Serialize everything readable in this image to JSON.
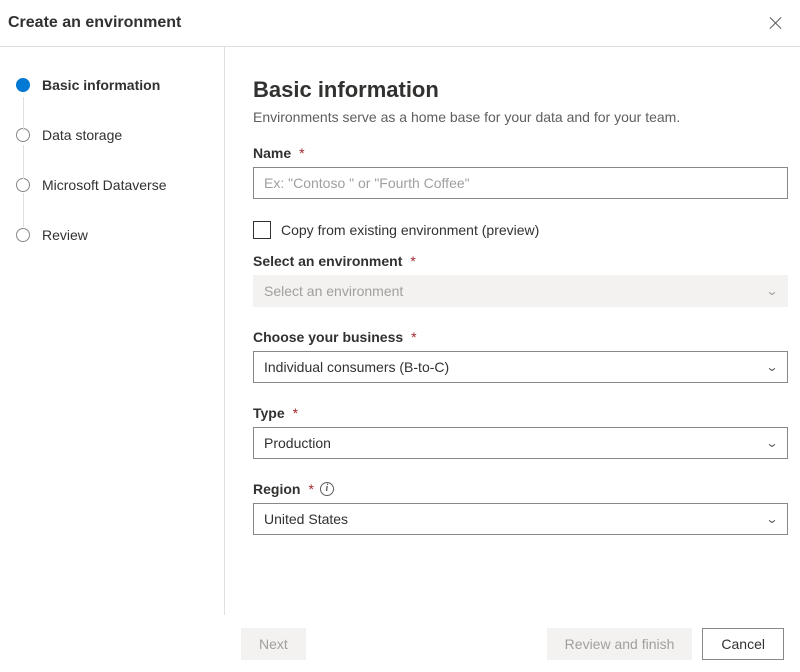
{
  "header": {
    "title": "Create an environment"
  },
  "sidebar": {
    "steps": [
      {
        "label": "Basic information",
        "active": true
      },
      {
        "label": "Data storage",
        "active": false
      },
      {
        "label": "Microsoft Dataverse",
        "active": false
      },
      {
        "label": "Review",
        "active": false
      }
    ]
  },
  "main": {
    "heading": "Basic information",
    "description": "Environments serve as a home base for your data and for your team.",
    "name_label": "Name",
    "name_placeholder": "Ex: \"Contoso \" or \"Fourth Coffee\"",
    "copy_label": "Copy from existing environment (preview)",
    "select_env_label": "Select an environment",
    "select_env_value": "Select an environment",
    "business_label": "Choose your business",
    "business_value": "Individual consumers (B-to-C)",
    "type_label": "Type",
    "type_value": "Production",
    "region_label": "Region",
    "region_value": "United States"
  },
  "footer": {
    "next": "Next",
    "review": "Review and finish",
    "cancel": "Cancel"
  }
}
